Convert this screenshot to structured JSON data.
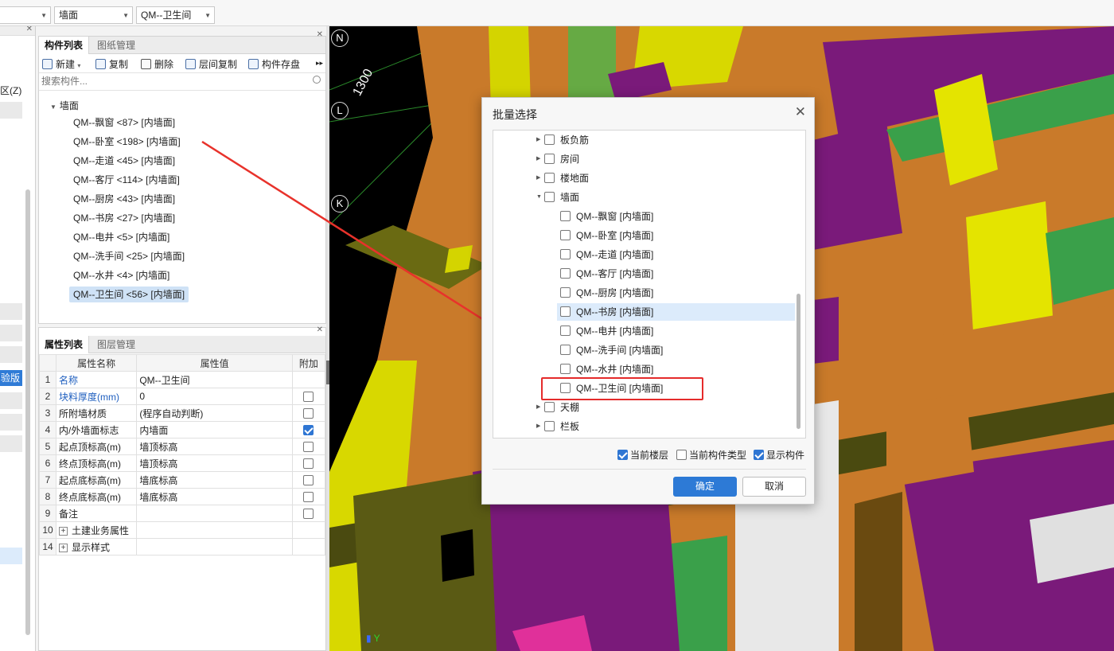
{
  "topbar": {
    "combo_floor": "",
    "combo_type": "墙面",
    "combo_component": "QM--卫生间"
  },
  "left_pane": {
    "partial_text": "区(Z)",
    "partial_badge": "验版"
  },
  "component_panel": {
    "tabs": [
      "构件列表",
      "图纸管理"
    ],
    "toolbar": {
      "new": "新建",
      "copy": "复制",
      "delete": "删除",
      "floor_copy": "层间复制",
      "save": "构件存盘"
    },
    "search_placeholder": "搜索构件...",
    "tree_root": "墙面",
    "items": [
      "QM--飘窗 <87> [内墙面]",
      "QM--卧室 <198> [内墙面]",
      "QM--走道 <45> [内墙面]",
      "QM--客厅 <114> [内墙面]",
      "QM--厨房 <43> [内墙面]",
      "QM--书房 <27> [内墙面]",
      "QM--电井 <5> [内墙面]",
      "QM--洗手间 <25> [内墙面]",
      "QM--水井 <4> [内墙面]",
      "QM--卫生间 <56> [内墙面]"
    ],
    "selected_index": 9
  },
  "property_panel": {
    "tabs": [
      "属性列表",
      "图层管理"
    ],
    "headers": [
      "属性名称",
      "属性值",
      "附加"
    ],
    "rows": [
      {
        "num": "1",
        "name": "名称",
        "value": "QM--卫生间",
        "blue": true,
        "check": null
      },
      {
        "num": "2",
        "name": "块料厚度(mm)",
        "value": "0",
        "blue": true,
        "check": false
      },
      {
        "num": "3",
        "name": "所附墙材质",
        "value": "(程序自动判断)",
        "blue": false,
        "check": false
      },
      {
        "num": "4",
        "name": "内/外墙面标志",
        "value": "内墙面",
        "blue": false,
        "check": true
      },
      {
        "num": "5",
        "name": "起点顶标高(m)",
        "value": "墙顶标高",
        "blue": false,
        "check": false
      },
      {
        "num": "6",
        "name": "终点顶标高(m)",
        "value": "墙顶标高",
        "blue": false,
        "check": false
      },
      {
        "num": "7",
        "name": "起点底标高(m)",
        "value": "墙底标高",
        "blue": false,
        "check": false
      },
      {
        "num": "8",
        "name": "终点底标高(m)",
        "value": "墙底标高",
        "blue": false,
        "check": false
      },
      {
        "num": "9",
        "name": "备注",
        "value": "",
        "blue": false,
        "check": false
      },
      {
        "num": "10",
        "name": "土建业务属性",
        "value": "",
        "blue": false,
        "check": null,
        "expand": true
      },
      {
        "num": "14",
        "name": "显示样式",
        "value": "",
        "blue": false,
        "check": null,
        "expand": true
      }
    ]
  },
  "viewport": {
    "axis_labels": [
      "N",
      "L",
      "K"
    ],
    "dimension": "1300",
    "ucs_label": "Y"
  },
  "dialog": {
    "title": "批量选择",
    "categories_top": [
      "板负筋",
      "房间",
      "楼地面",
      "墙面"
    ],
    "wall_items": [
      "QM--飘窗 [内墙面]",
      "QM--卧室 [内墙面]",
      "QM--走道 [内墙面]",
      "QM--客厅 [内墙面]",
      "QM--厨房 [内墙面]",
      "QM--书房 [内墙面]",
      "QM--电井 [内墙面]",
      "QM--洗手间 [内墙面]",
      "QM--水井 [内墙面]",
      "QM--卫生间 [内墙面]"
    ],
    "categories_bottom": [
      "天棚",
      "栏板"
    ],
    "options": {
      "current_floor": "当前楼层",
      "current_type": "当前构件类型",
      "show_components": "显示构件"
    },
    "ok": "确定",
    "cancel": "取消"
  },
  "colors": {
    "accent": "#2d7ad6",
    "highlight_box": "#e52b2b",
    "selection": "#cfe2f6"
  }
}
